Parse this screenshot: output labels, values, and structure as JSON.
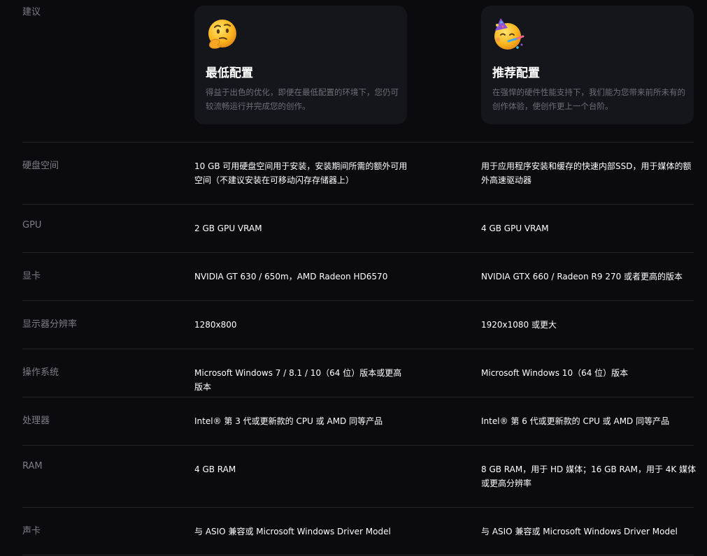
{
  "header": {
    "label": "建议"
  },
  "cards": {
    "minimum": {
      "emoji": "thinking-face-icon",
      "title": "最低配置",
      "description": "得益于出色的优化，即便在最低配置的环境下，您仍可较流畅运行并完成您的创作。"
    },
    "recommended": {
      "emoji": "partying-face-icon",
      "title": "推荐配置",
      "description": "在强悍的硬件性能支持下，我们能为您带来前所未有的创作体验，使创作更上一个台阶。"
    }
  },
  "rows": [
    {
      "label": "硬盘空间",
      "minimum": "10 GB 可用硬盘空间用于安装，安装期间所需的额外可用空间（不建议安装在可移动闪存存储器上）",
      "recommended": "用于应用程序安装和缓存的快速内部SSD，用于媒体的额外高速驱动器"
    },
    {
      "label": "GPU",
      "minimum": "2 GB GPU VRAM",
      "recommended": "4 GB GPU VRAM"
    },
    {
      "label": "显卡",
      "minimum": "NVIDIA GT 630 / 650m，AMD Radeon HD6570",
      "recommended": "NVIDIA GTX 660 / Radeon R9 270 或者更高的版本"
    },
    {
      "label": "显示器分辨率",
      "minimum": "1280x800",
      "recommended": "1920x1080 或更大"
    },
    {
      "label": "操作系统",
      "minimum": "Microsoft Windows 7 / 8.1 / 10（64 位）版本或更高版本",
      "recommended": "Microsoft Windows 10（64 位）版本"
    },
    {
      "label": "处理器",
      "minimum": "Intel® 第 3 代或更新款的 CPU 或 AMD 同等产品",
      "recommended": "Intel® 第 6 代或更新款的 CPU 或 AMD 同等产品"
    },
    {
      "label": "RAM",
      "minimum": "4 GB RAM",
      "recommended": "8 GB RAM，用于 HD 媒体；16 GB RAM，用于 4K 媒体或更高分辨率"
    },
    {
      "label": "声卡",
      "minimum": "与 ASIO 兼容或 Microsoft Windows Driver Model",
      "recommended": "与 ASIO 兼容或 Microsoft Windows Driver Model"
    }
  ]
}
